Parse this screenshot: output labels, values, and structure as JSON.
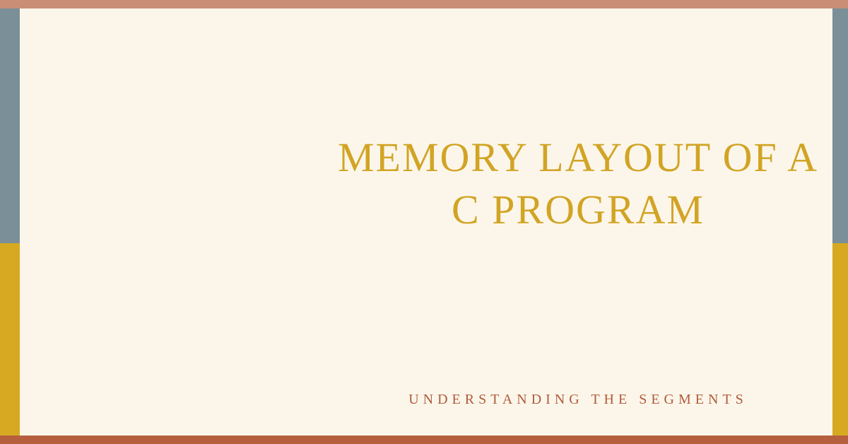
{
  "title": "MEMORY LAYOUT OF A C PROGRAM",
  "subtitle": "UNDERSTANDING THE SEGMENTS",
  "colors": {
    "topBar": "#c98e75",
    "bottomBar": "#b55f3e",
    "sideTop": "#7a8f98",
    "sideBottom": "#d7a922",
    "card": "#fcf6ea",
    "titleText": "#d2a424",
    "subtitleText": "#b15a3a"
  }
}
